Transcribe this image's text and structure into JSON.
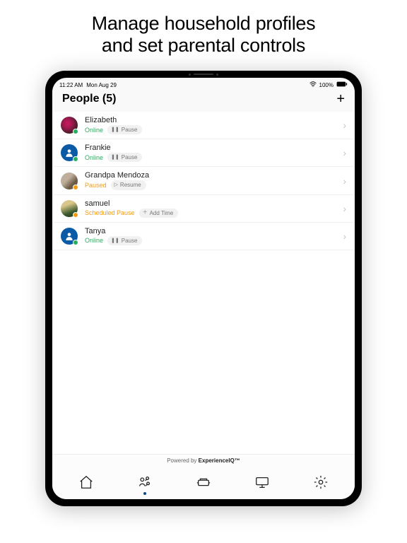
{
  "promo": {
    "line1": "Manage household profiles",
    "line2": "and set parental controls"
  },
  "statusbar": {
    "time": "11:22 AM",
    "date": "Mon Aug 29",
    "battery_pct": "100%"
  },
  "header": {
    "title": "People (5)"
  },
  "people": [
    {
      "name": "Elizabeth",
      "status_label": "Online",
      "status_kind": "online",
      "action_label": "Pause",
      "action_kind": "pause",
      "avatar_class": "img1"
    },
    {
      "name": "Frankie",
      "status_label": "Online",
      "status_kind": "online",
      "action_label": "Pause",
      "action_kind": "pause",
      "avatar_class": "img2"
    },
    {
      "name": "Grandpa Mendoza",
      "status_label": "Paused",
      "status_kind": "paused",
      "action_label": "Resume",
      "action_kind": "resume",
      "avatar_class": "img3"
    },
    {
      "name": "samuel",
      "status_label": "Scheduled Pause",
      "status_kind": "sched",
      "action_label": "Add Time",
      "action_kind": "addtime",
      "avatar_class": "img4"
    },
    {
      "name": "Tanya",
      "status_label": "Online",
      "status_kind": "online",
      "action_label": "Pause",
      "action_kind": "pause",
      "avatar_class": "img5"
    }
  ],
  "footer": {
    "powered_prefix": "Powered by ",
    "powered_brand": "ExperienceIQ™"
  },
  "tabs": [
    {
      "id": "home",
      "active": false
    },
    {
      "id": "people",
      "active": true
    },
    {
      "id": "things",
      "active": false
    },
    {
      "id": "network",
      "active": false
    },
    {
      "id": "settings",
      "active": false
    }
  ],
  "colors": {
    "online": "#27ae60",
    "paused": "#f39c12",
    "brand": "#0b4a8a"
  }
}
